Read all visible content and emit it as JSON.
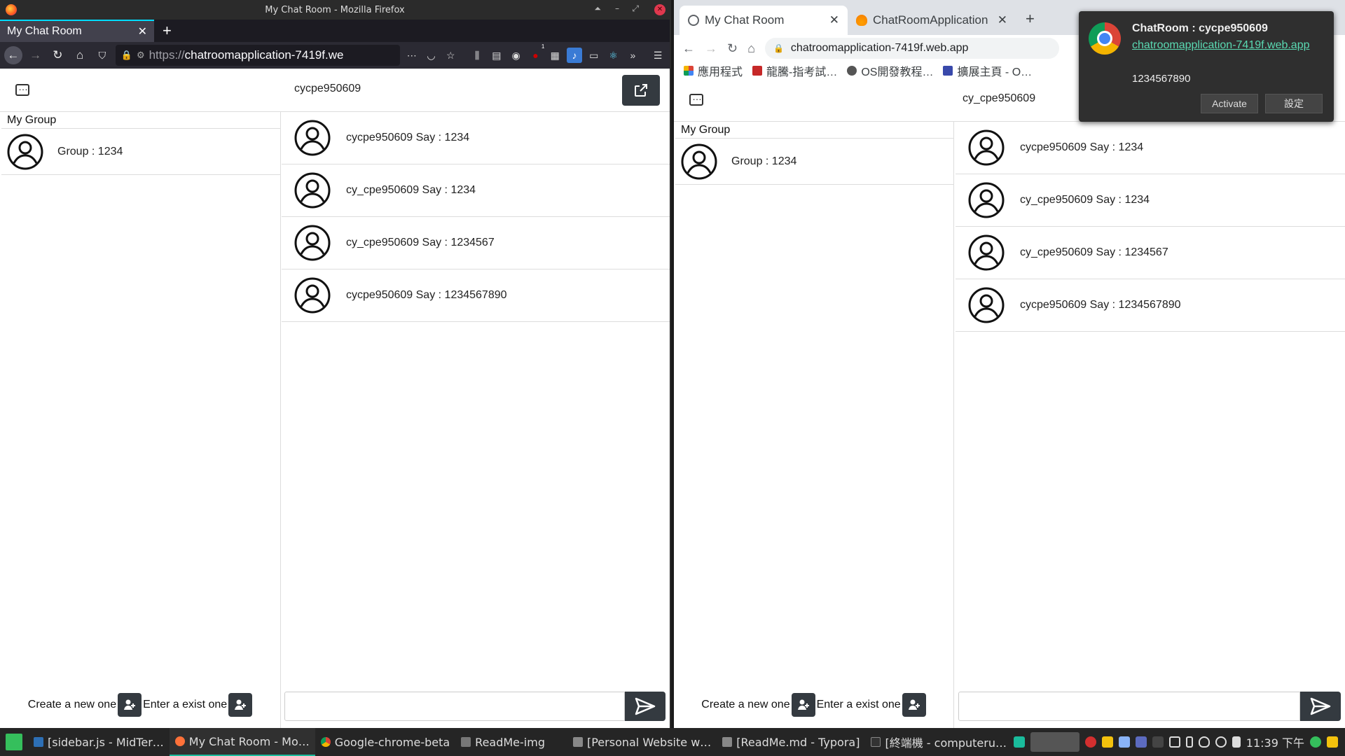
{
  "firefox": {
    "window_title": "My Chat Room - Mozilla Firefox",
    "tab_title": "My Chat Room",
    "url_proto": "https://",
    "url_host": "chatroomapplication-7419f.we",
    "ublock_badge": "1"
  },
  "chrome": {
    "tabs": [
      {
        "label": "My Chat Room"
      },
      {
        "label": "ChatRoomApplication"
      }
    ],
    "url": "chatroomapplication-7419f.web.app",
    "bookmarks": [
      {
        "label": "應用程式"
      },
      {
        "label": "龍騰-指考試…"
      },
      {
        "label": "OS開發教程…"
      },
      {
        "label": "擴展主頁 - O…"
      }
    ],
    "notification": {
      "title": "ChatRoom : cycpe950609",
      "link": "chatroomapplication-7419f.web.app",
      "body": "1234567890",
      "activate": "Activate",
      "settings": "設定"
    }
  },
  "apps": [
    {
      "username": "cycpe950609",
      "sidebar_title": "My Group",
      "groups": [
        {
          "label": "Group : 1234"
        }
      ],
      "create_label": "Create a new one",
      "enter_label": "Enter a exist one",
      "messages": [
        {
          "text": "cycpe950609 Say : 1234"
        },
        {
          "text": "cy_cpe950609 Say : 1234"
        },
        {
          "text": "cy_cpe950609 Say : 1234567"
        },
        {
          "text": "cycpe950609 Say : 1234567890"
        }
      ],
      "input_value": ""
    },
    {
      "username": "cy_cpe950609",
      "sidebar_title": "My Group",
      "groups": [
        {
          "label": "Group : 1234"
        }
      ],
      "create_label": "Create a new one",
      "enter_label": "Enter a exist one",
      "messages": [
        {
          "text": "cycpe950609 Say : 1234"
        },
        {
          "text": "cy_cpe950609 Say : 1234"
        },
        {
          "text": "cy_cpe950609 Say : 1234567"
        },
        {
          "text": "cycpe950609 Say : 1234567890"
        }
      ],
      "input_value": ""
    }
  ],
  "taskbar": {
    "items": [
      {
        "label": "[sidebar.js - MidTer…"
      },
      {
        "label": "My Chat Room - Mo…"
      },
      {
        "label": "Google-chrome-beta"
      },
      {
        "label": "ReadMe-img"
      },
      {
        "label": "[Personal Website w…"
      },
      {
        "label": "[ReadMe.md - Typora]"
      },
      {
        "label": "[終端機 - computeru…"
      }
    ],
    "clock": "11:39 下午"
  }
}
